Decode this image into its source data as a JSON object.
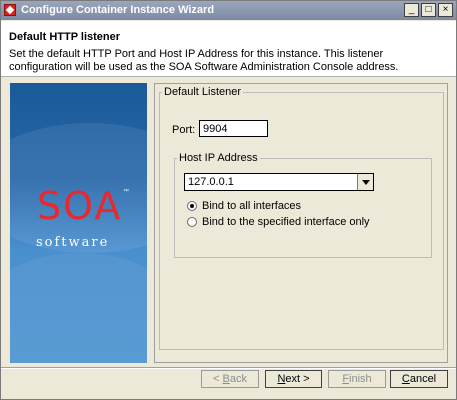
{
  "window": {
    "title": "Configure Container Instance Wizard",
    "buttons": [
      "_",
      "□",
      "×"
    ]
  },
  "header": {
    "title": "Default HTTP listener",
    "description": "Set the default HTTP Port and Host IP Address for this instance. This listener configuration will be used as the SOA Software Administration Console address."
  },
  "banner": {
    "logo": "SOA",
    "tm": "™",
    "subtitle": "software"
  },
  "form": {
    "group_label": "Default Listener",
    "port_label": "Port:",
    "port_value": "9904",
    "host_group_label": "Host IP Address",
    "host_ip": "127.0.0.1",
    "radio_all": "Bind to all interfaces",
    "radio_specific": "Bind to the specified interface only",
    "selected_binding": "all"
  },
  "footer": {
    "back_key": "B",
    "back_rest": "ack",
    "back_prefix": "< ",
    "next_key": "N",
    "next_rest": "ext >",
    "finish_key": "F",
    "finish_rest": "inish",
    "cancel_key": "C",
    "cancel_rest": "ancel"
  }
}
